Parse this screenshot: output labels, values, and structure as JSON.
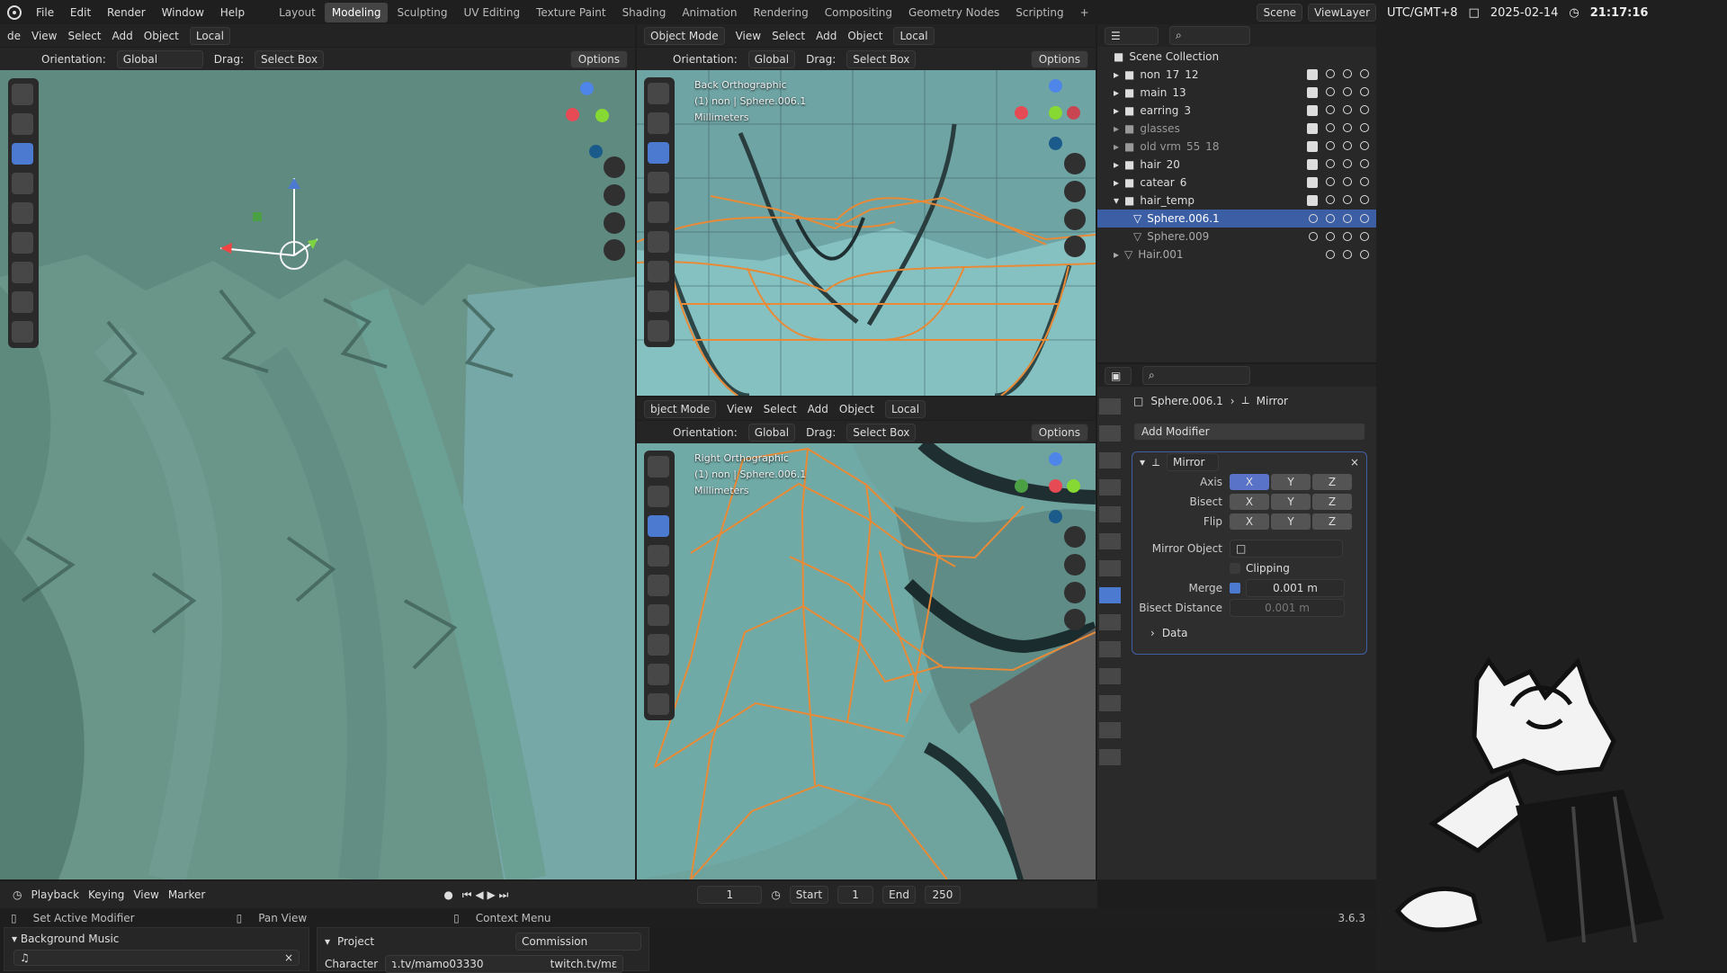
{
  "topbar": {
    "menu": [
      "File",
      "Edit",
      "Render",
      "Window",
      "Help"
    ],
    "workspaces": [
      "Layout",
      "Modeling",
      "Sculpting",
      "UV Editing",
      "Texture Paint",
      "Shading",
      "Animation",
      "Rendering",
      "Compositing",
      "Geometry Nodes",
      "Scripting"
    ],
    "active_workspace": "Modeling",
    "scene": "Scene",
    "view_layer": "ViewLayer",
    "plus": "+"
  },
  "left_view": {
    "toolbar": [
      "View",
      "Select",
      "Add",
      "Object"
    ],
    "mode": "de",
    "local": "Local",
    "orientation_label": "Orientation:",
    "orientation": "Global",
    "drag_label": "Drag:",
    "drag": "Select Box",
    "options": "Options"
  },
  "top_right_view": {
    "mode": "Object Mode",
    "toolbar": [
      "View",
      "Select",
      "Add",
      "Object"
    ],
    "local": "Local",
    "orientation_label": "Orientation:",
    "orientation": "Global",
    "drag_label": "Drag:",
    "drag": "Select Box",
    "options": "Options",
    "info": [
      "Back Orthographic",
      "(1) non | Sphere.006.1",
      "Millimeters"
    ]
  },
  "bottom_right_view": {
    "mode": "bject Mode",
    "toolbar": [
      "View",
      "Select",
      "Add",
      "Object"
    ],
    "local": "Local",
    "orientation_label": "Orientation:",
    "orientation": "Global",
    "drag_label": "Drag:",
    "drag": "Select Box",
    "options": "Options",
    "info": [
      "Right Orthographic",
      "(1) non | Sphere.006.1",
      "Millimeters"
    ]
  },
  "outliner": {
    "title": "Scene Collection",
    "rows": [
      {
        "name": "non",
        "badge1": "17",
        "badge2": "12"
      },
      {
        "name": "main",
        "badge1": "13",
        "badge2": ""
      },
      {
        "name": "earring",
        "badge1": "3",
        "badge2": ""
      },
      {
        "name": "glasses",
        "badge1": "",
        "badge2": ""
      },
      {
        "name": "old vrm",
        "badge1": "55",
        "badge2": "18"
      },
      {
        "name": "hair",
        "badge1": "20",
        "badge2": ""
      },
      {
        "name": "catear",
        "badge1": "6",
        "badge2": ""
      },
      {
        "name": "hair_temp",
        "badge1": "",
        "badge2": ""
      },
      {
        "name": "Sphere.006.1",
        "badge1": "",
        "badge2": ""
      },
      {
        "name": "Sphere.009",
        "badge1": "",
        "badge2": ""
      },
      {
        "name": "Hair.001",
        "badge1": "",
        "badge2": ""
      }
    ]
  },
  "properties": {
    "object": "Sphere.006.1",
    "modifier": "Mirror",
    "add_modifier": "Add Modifier",
    "axis_label": "Axis",
    "bisect_label": "Bisect",
    "flip_label": "Flip",
    "axis": [
      "X",
      "Y",
      "Z"
    ],
    "mirror_object_label": "Mirror Object",
    "clipping": "Clipping",
    "merge_label": "Merge",
    "merge_value": "0.001 m",
    "bisect_distance_label": "Bisect Distance",
    "bisect_distance": "0.001 m",
    "data": "Data"
  },
  "timeline": {
    "menus": [
      "Playback",
      "Keying",
      "View",
      "Marker"
    ],
    "frame": "1",
    "start_label": "Start",
    "start": "1",
    "end_label": "End",
    "end": "250"
  },
  "status": {
    "set_active": "Set Active Modifier",
    "pan": "Pan View",
    "context": "Context Menu",
    "version": "3.6.3"
  },
  "overlay": {
    "timezone": "UTC/GMT+8",
    "date": "2025-02-14",
    "time": "21:17:16"
  },
  "bottom_panels": {
    "music_title": "Background Music",
    "project_title": "Project",
    "project_value": "Commission",
    "character_label": "Character",
    "character_value": "ɿ.tv/mamo03330",
    "character_link": "twitch.tv/mε"
  },
  "colors": {
    "active_blue": "#4c7ad1",
    "selected": "#3c5ea5",
    "viewport_green": "#6a9589",
    "wire_orange": "#e88a36"
  }
}
